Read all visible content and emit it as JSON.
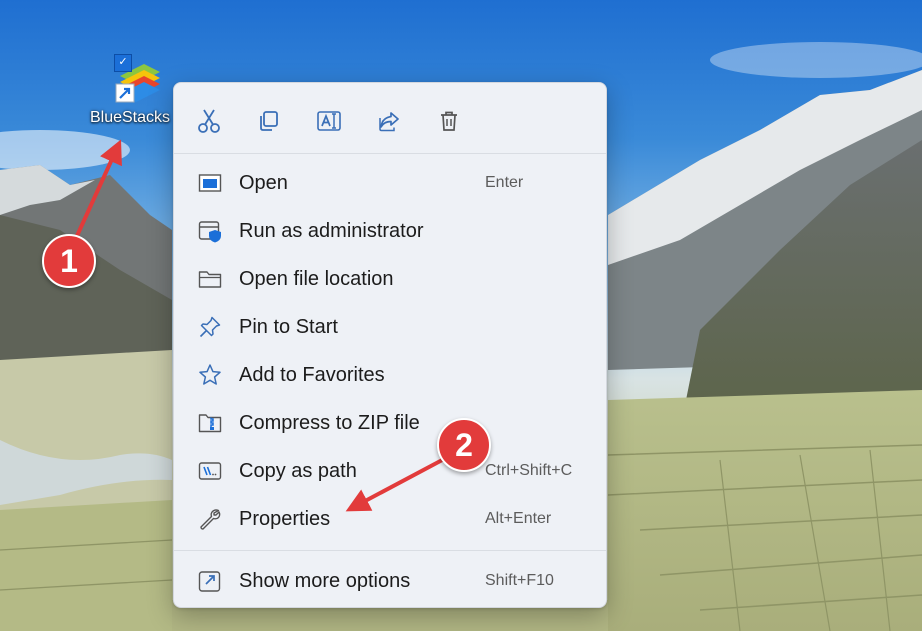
{
  "desktop": {
    "icon": {
      "label": "BlueStacks",
      "check_glyph": "✓",
      "icon_name": "bluestacks-app-icon",
      "shortcut_glyph": "shortcut-arrow-icon"
    }
  },
  "context_menu": {
    "toolbar": [
      {
        "icon": "cut-icon"
      },
      {
        "icon": "copy-icon"
      },
      {
        "icon": "rename-icon"
      },
      {
        "icon": "share-icon"
      },
      {
        "icon": "delete-icon"
      }
    ],
    "items": [
      {
        "label": "Open",
        "shortcut": "Enter",
        "icon": "open-window-icon"
      },
      {
        "label": "Run as administrator",
        "shortcut": "",
        "icon": "admin-shield-icon"
      },
      {
        "label": "Open file location",
        "shortcut": "",
        "icon": "folder-icon"
      },
      {
        "label": "Pin to Start",
        "shortcut": "",
        "icon": "pin-icon"
      },
      {
        "label": "Add to Favorites",
        "shortcut": "",
        "icon": "star-icon"
      },
      {
        "label": "Compress to ZIP file",
        "shortcut": "",
        "icon": "zip-folder-icon"
      },
      {
        "label": "Copy as path",
        "shortcut": "Ctrl+Shift+C",
        "icon": "copy-path-icon"
      },
      {
        "label": "Properties",
        "shortcut": "Alt+Enter",
        "icon": "wrench-icon"
      },
      {
        "label": "Show more options",
        "shortcut": "Shift+F10",
        "icon": "more-options-icon"
      }
    ]
  },
  "annotations": {
    "step1": "1",
    "step2": "2",
    "color": "#e23b3b"
  }
}
